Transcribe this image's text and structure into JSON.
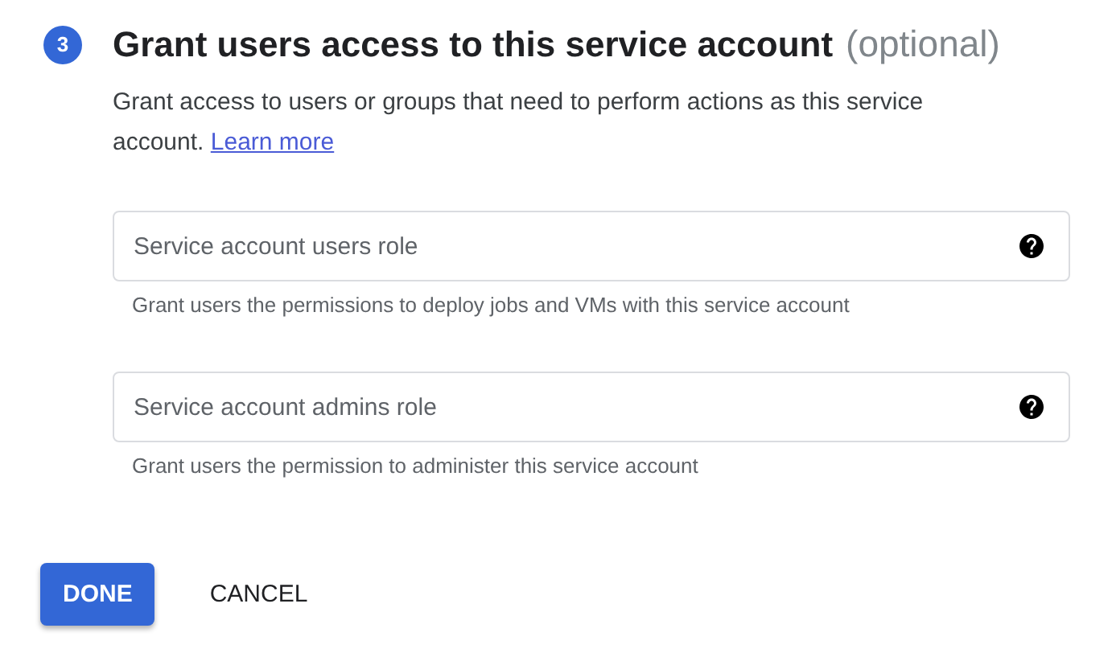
{
  "step": {
    "number": "3",
    "title": "Grant users access to this service account",
    "title_suffix": "(optional)",
    "description": "Grant access to users or groups that need to perform actions as this service account.",
    "link": "Learn more"
  },
  "fields": [
    {
      "placeholder": "Service account users role",
      "hint": "Grant users the permissions to deploy jobs and VMs with this service account"
    },
    {
      "placeholder": "Service account admins role",
      "hint": "Grant users the permission to administer this service account"
    }
  ],
  "buttons": [
    {
      "label": "DONE",
      "kind": "primary"
    },
    {
      "label": "CANCEL",
      "kind": "text"
    }
  ]
}
